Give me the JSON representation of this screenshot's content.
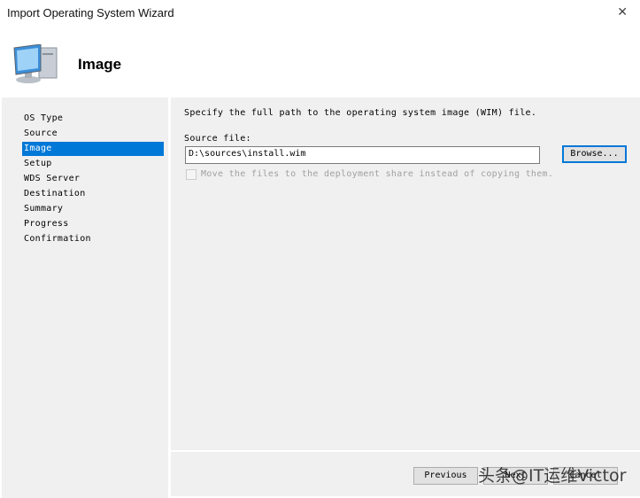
{
  "window": {
    "title": "Import Operating System Wizard",
    "close": "✕"
  },
  "header": {
    "title": "Image",
    "icon": "computer-icon"
  },
  "nav": {
    "items": [
      "OS Type",
      "Source",
      "Image",
      "Setup",
      "WDS Server",
      "Destination",
      "Summary",
      "Progress",
      "Confirmation"
    ],
    "selected": "Image"
  },
  "main": {
    "instruction": "Specify the full path to the operating system image (WIM) file.",
    "source_label": "Source file:",
    "source_value": "D:\\sources\\install.wim",
    "browse": "Browse...",
    "move_checkbox": "Move the files to the deployment share instead of copying them.",
    "move_checked": false
  },
  "footer": {
    "previous": "Previous",
    "next": "Next",
    "cancel": "Cancel"
  },
  "watermark": "头条@IT运维Victor"
}
